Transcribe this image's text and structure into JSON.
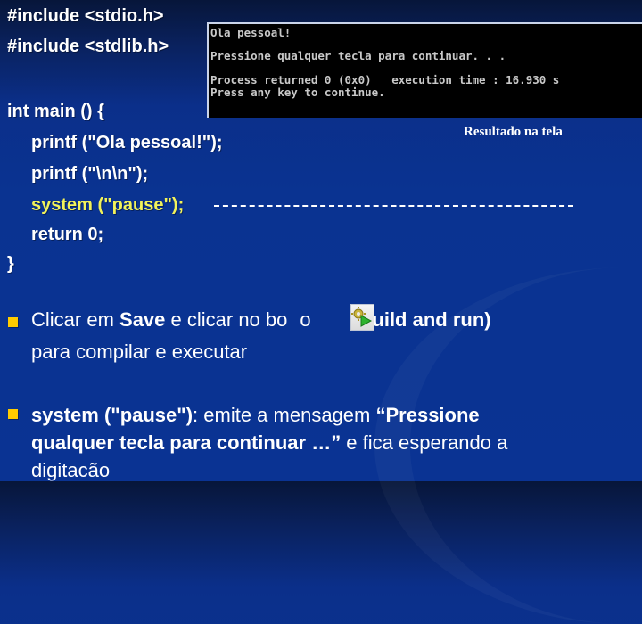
{
  "slide": {
    "code_lines": [
      "#include <stdio.h>",
      "#include <stdlib.h>",
      "int main () {",
      "printf (\"Ola pessoal!\");",
      "printf (\"\\n\\n\");",
      "system (\"pause\");",
      "return 0;",
      "}"
    ],
    "console": {
      "lines": [
        "Ola pessoal!",
        "Pressione qualquer tecla para continuar. . .",
        "Process returned 0 (0x0)   execution time : 16.930 s",
        "Press any key to continue."
      ]
    },
    "caption": "Resultado na tela",
    "bullets": [
      {
        "p1": "Clicar em ",
        "p1_bold": "Save",
        "p2": " e clicar no bo",
        "p3": "o",
        "p4_bold": "(build and run)",
        "line2": "para compilar e executar",
        "icon": "build-and-run-icon"
      },
      {
        "p1_bold": "system (\"pause\")",
        "p2": ": emite a mensagem ",
        "p3_bold": "“Pressione",
        "line2_bold": "qualquer tecla para continuar …”",
        "line2_rest": " e fica esperando a",
        "line3": "digitacão"
      }
    ],
    "colors": {
      "background": "#0a3391",
      "highlight": "#f2f25a",
      "bullet": "#ffcc00",
      "console_bg": "#000000",
      "console_text": "#c8c8c8"
    }
  }
}
